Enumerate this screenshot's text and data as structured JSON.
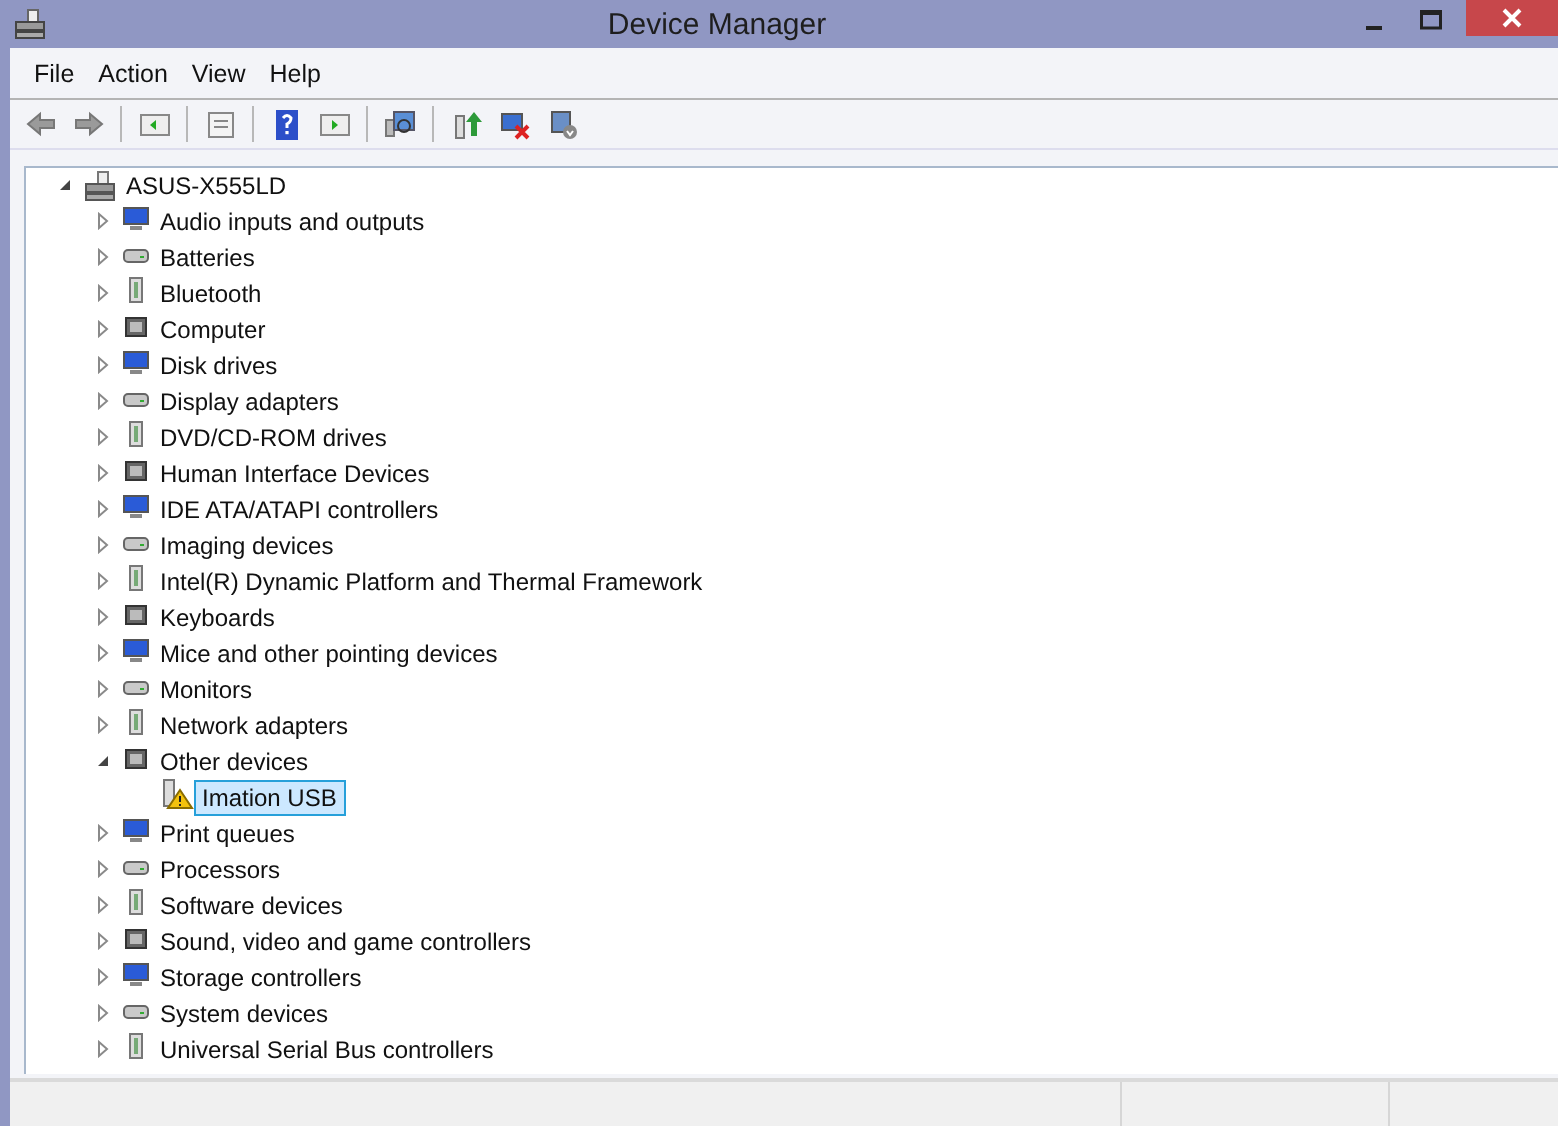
{
  "window": {
    "title": "Device Manager"
  },
  "menu": [
    "File",
    "Action",
    "View",
    "Help"
  ],
  "tree": {
    "label": "ASUS-X555LD",
    "expanded": true,
    "selected": false,
    "children": [
      {
        "label": "Audio inputs and outputs",
        "expanded": false,
        "selected": false
      },
      {
        "label": "Batteries",
        "expanded": false,
        "selected": false
      },
      {
        "label": "Bluetooth",
        "expanded": false,
        "selected": false
      },
      {
        "label": "Computer",
        "expanded": false,
        "selected": false
      },
      {
        "label": "Disk drives",
        "expanded": false,
        "selected": false
      },
      {
        "label": "Display adapters",
        "expanded": false,
        "selected": false
      },
      {
        "label": "DVD/CD-ROM drives",
        "expanded": false,
        "selected": false
      },
      {
        "label": "Human Interface Devices",
        "expanded": false,
        "selected": false
      },
      {
        "label": "IDE ATA/ATAPI controllers",
        "expanded": false,
        "selected": false
      },
      {
        "label": "Imaging devices",
        "expanded": false,
        "selected": false
      },
      {
        "label": "Intel(R) Dynamic Platform and Thermal Framework",
        "expanded": false,
        "selected": false
      },
      {
        "label": "Keyboards",
        "expanded": false,
        "selected": false
      },
      {
        "label": "Mice and other pointing devices",
        "expanded": false,
        "selected": false
      },
      {
        "label": "Monitors",
        "expanded": false,
        "selected": false
      },
      {
        "label": "Network adapters",
        "expanded": false,
        "selected": false
      },
      {
        "label": "Other devices",
        "expanded": true,
        "selected": false,
        "children": [
          {
            "label": "Imation USB",
            "selected": true,
            "warning": true
          }
        ]
      },
      {
        "label": "Print queues",
        "expanded": false,
        "selected": false
      },
      {
        "label": "Processors",
        "expanded": false,
        "selected": false
      },
      {
        "label": "Software devices",
        "expanded": false,
        "selected": false
      },
      {
        "label": "Sound, video and game controllers",
        "expanded": false,
        "selected": false
      },
      {
        "label": "Storage controllers",
        "expanded": false,
        "selected": false
      },
      {
        "label": "System devices",
        "expanded": false,
        "selected": false
      },
      {
        "label": "Universal Serial Bus controllers",
        "expanded": false,
        "selected": false
      }
    ]
  }
}
